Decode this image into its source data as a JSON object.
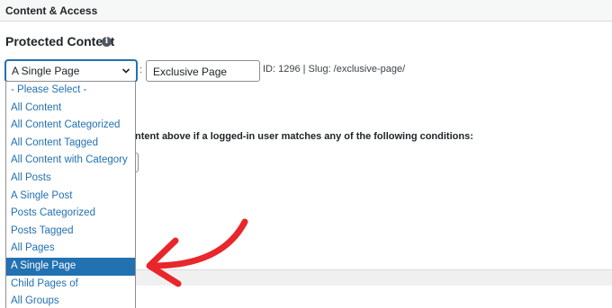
{
  "panel": {
    "title": "Content & Access"
  },
  "protected_content": {
    "title": "Protected Content",
    "info_icon": "info-icon",
    "select": {
      "value": "A Single Page"
    },
    "colon": ":",
    "page_input": {
      "value": "Exclusive Page"
    },
    "meta": "ID: 1296 | Slug: /exclusive-page/"
  },
  "behind_text": "ntent above if a logged-in user matches any of the following conditions:",
  "dropdown": {
    "options": [
      "- Please Select -",
      "All Content",
      "All Content Categorized",
      "All Content Tagged",
      "All Content with Category",
      "All Posts",
      "A Single Post",
      "Posts Categorized",
      "Posts Tagged",
      "All Pages",
      "A Single Page",
      "Child Pages of",
      "All Groups"
    ],
    "selected_index": 10
  },
  "colors": {
    "accent": "#2271b1",
    "annotation_arrow": "#e8262b",
    "header_bg": "#f6f7f7"
  },
  "annotation": {
    "icon": "red-curved-arrow-icon"
  }
}
